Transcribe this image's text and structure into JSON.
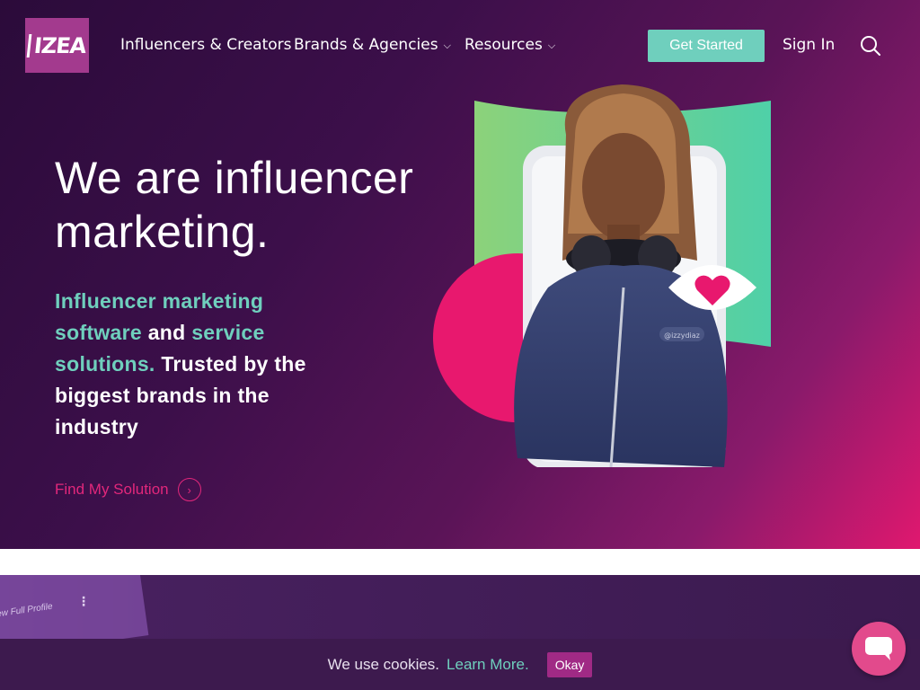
{
  "brand": {
    "logo_text": "IZEA"
  },
  "nav": {
    "items": [
      {
        "label": "Influencers & Creators",
        "dropdown": false
      },
      {
        "label": "Brands & Agencies",
        "dropdown": true
      },
      {
        "label": "Resources",
        "dropdown": true
      }
    ],
    "cta_label": "Get Started",
    "signin_label": "Sign In"
  },
  "hero": {
    "headline_line1": "We are influencer",
    "headline_line2": "marketing.",
    "sub": {
      "hl1": "Influencer marketing",
      "hl2": "software",
      "t1": "and",
      "hl3": "service",
      "hl4": "solutions.",
      "t2": "Trusted by the biggest brands in the industry"
    },
    "find_label": "Find My Solution",
    "handle_tag": "@izzydiaz"
  },
  "lower": {
    "card_text": "ew Full Profile"
  },
  "cookie": {
    "text": "We use cookies.",
    "link": "Learn More.",
    "okay_label": "Okay"
  },
  "colors": {
    "accent_teal": "#6fcfbd",
    "accent_pink": "#e2277b",
    "logo_bg": "#a33a8e"
  }
}
